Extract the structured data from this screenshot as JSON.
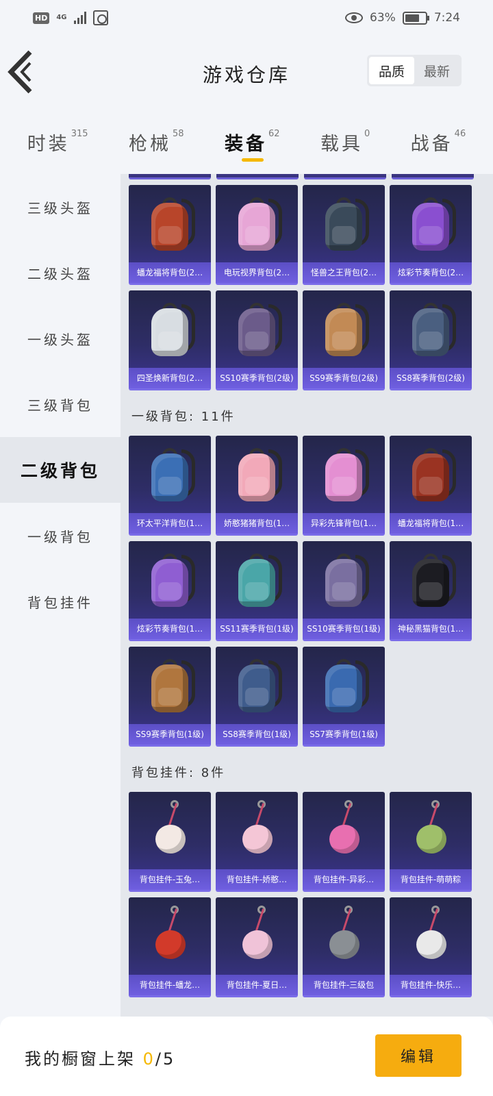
{
  "status_bar": {
    "hd": "HD",
    "network": "4G",
    "battery": "63%",
    "time": "7:24"
  },
  "header": {
    "title": "游戏仓库",
    "sort_options": [
      "品质",
      "最新"
    ],
    "active_sort": "品质"
  },
  "tabs": [
    {
      "label": "时装",
      "count": "315"
    },
    {
      "label": "枪械",
      "count": "58"
    },
    {
      "label": "装备",
      "count": "62",
      "active": true
    },
    {
      "label": "载具",
      "count": "0"
    },
    {
      "label": "战备",
      "count": "46"
    }
  ],
  "sidebar": {
    "items": [
      "三级头盔",
      "二级头盔",
      "一级头盔",
      "三级背包",
      "二级背包",
      "一级背包",
      "背包挂件"
    ],
    "active": "二级背包"
  },
  "level2_bags": [
    {
      "name": "蟠龙福将背包(2…",
      "icon": "dragon-backpack-icon",
      "color": "#b8452a"
    },
    {
      "name": "电玩视界背包(2…",
      "icon": "arcade-backpack-icon",
      "color": "#e7a6d6"
    },
    {
      "name": "怪兽之王背包(2…",
      "icon": "monster-backpack-icon",
      "color": "#3a4a5a"
    },
    {
      "name": "炫彩节奏背包(2…",
      "icon": "rhythm-backpack-icon",
      "color": "#8a4fd0"
    },
    {
      "name": "四圣焕新背包(2…",
      "icon": "white-backpack-icon",
      "color": "#d8dde2"
    },
    {
      "name": "SS10赛季背包(2级)",
      "icon": "ss10-backpack-icon",
      "color": "#6b5b8a"
    },
    {
      "name": "SS9赛季背包(2级)",
      "icon": "ss9-backpack-icon",
      "color": "#c28a55"
    },
    {
      "name": "SS8赛季背包(2级)",
      "icon": "ss8-backpack-icon",
      "color": "#4a5f80"
    }
  ],
  "level1_section": {
    "label": "一级背包",
    "count_text": ": 11件"
  },
  "level1_bags": [
    {
      "name": "环太平洋背包(1…",
      "icon": "pacific-backpack-icon",
      "color": "#3b6fb5"
    },
    {
      "name": "娇憨猪猪背包(1…",
      "icon": "piggy-backpack-icon",
      "color": "#f2a9b9"
    },
    {
      "name": "异彩先锋背包(1…",
      "icon": "vanguard-backpack-icon",
      "color": "#e48fd2"
    },
    {
      "name": "蟠龙福将背包(1…",
      "icon": "dragon-backpack-icon",
      "color": "#9a3322"
    },
    {
      "name": "炫彩节奏背包(1…",
      "icon": "rhythm-backpack-icon",
      "color": "#8f5ed2"
    },
    {
      "name": "SS11赛季背包(1级)",
      "icon": "ss11-backpack-icon",
      "color": "#4aa6a8"
    },
    {
      "name": "SS10赛季背包(1级)",
      "icon": "ss10-backpack-icon",
      "color": "#7a6fa0"
    },
    {
      "name": "神秘黑猫背包(1…",
      "icon": "black-cat-backpack-icon",
      "color": "#1c1c22"
    },
    {
      "name": "SS9赛季背包(1级)",
      "icon": "ss9-backpack-icon",
      "color": "#b0763e"
    },
    {
      "name": "SS8赛季背包(1级)",
      "icon": "ss8-backpack-icon",
      "color": "#3f5c8c"
    },
    {
      "name": "SS7赛季背包(1级)",
      "icon": "ss7-backpack-icon",
      "color": "#3a6ab0"
    }
  ],
  "charm_section": {
    "label": "背包挂件",
    "count_text": ": 8件"
  },
  "charms": [
    {
      "name": "背包挂件-玉兔…",
      "icon": "rabbit-charm-icon",
      "color": "#f3e9e4"
    },
    {
      "name": "背包挂件-娇憨…",
      "icon": "pig-charm-icon",
      "color": "#f4c6d6"
    },
    {
      "name": "背包挂件-异彩…",
      "icon": "skate-charm-icon",
      "color": "#e86fb0"
    },
    {
      "name": "背包挂件-萌萌粽",
      "icon": "zongzi-charm-icon",
      "color": "#9fbf6a"
    },
    {
      "name": "背包挂件-蟠龙…",
      "icon": "dragon-charm-icon",
      "color": "#d23a2a"
    },
    {
      "name": "背包挂件-夏日…",
      "icon": "icecream-charm-icon",
      "color": "#f0c3d8"
    },
    {
      "name": "背包挂件-三级包",
      "icon": "backpack-charm-icon",
      "color": "#8a8f94"
    },
    {
      "name": "背包挂件-快乐…",
      "icon": "happy-charm-icon",
      "color": "#e9e9e9"
    }
  ],
  "bottom_bar": {
    "label": "我的橱窗上架",
    "used": "0",
    "total": "/5",
    "edit_label": "编辑"
  }
}
